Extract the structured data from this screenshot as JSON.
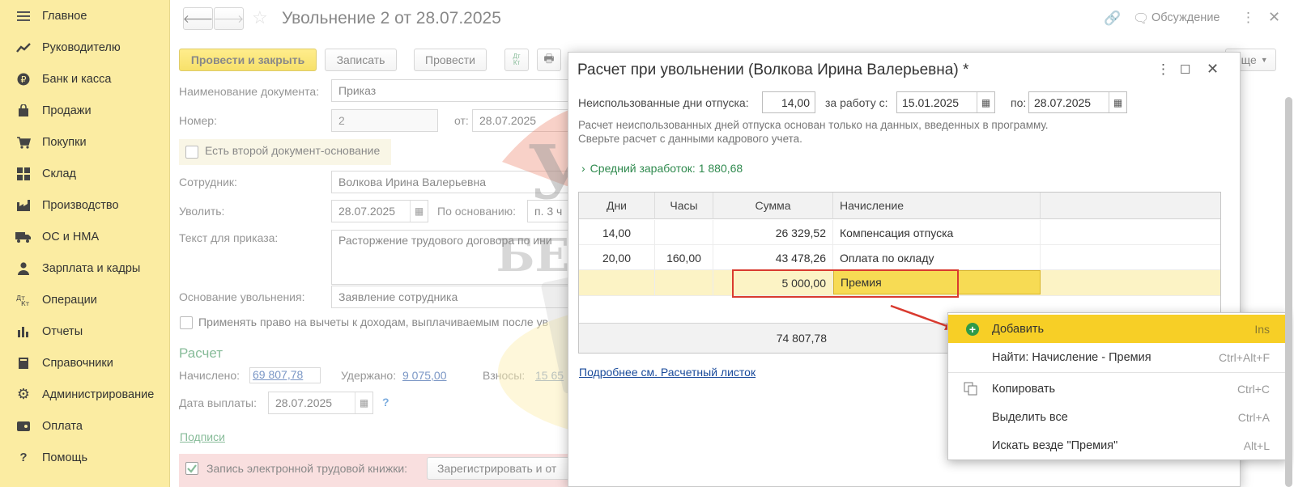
{
  "sidebar": {
    "items": [
      {
        "label": "Главное",
        "icon": "menu-icon"
      },
      {
        "label": "Руководителю",
        "icon": "trend-icon"
      },
      {
        "label": "Банк и касса",
        "icon": "ruble-icon"
      },
      {
        "label": "Продажи",
        "icon": "bag-icon"
      },
      {
        "label": "Покупки",
        "icon": "cart-icon"
      },
      {
        "label": "Склад",
        "icon": "grid-icon"
      },
      {
        "label": "Производство",
        "icon": "factory-icon"
      },
      {
        "label": "ОС и НМА",
        "icon": "truck-icon"
      },
      {
        "label": "Зарплата и кадры",
        "icon": "person-icon"
      },
      {
        "label": "Операции",
        "icon": "dtkt-icon"
      },
      {
        "label": "Отчеты",
        "icon": "barchart-icon"
      },
      {
        "label": "Справочники",
        "icon": "book-icon"
      },
      {
        "label": "Администрирование",
        "icon": "gear-icon"
      },
      {
        "label": "Оплата",
        "icon": "wallet-icon"
      },
      {
        "label": "Помощь",
        "icon": "question-icon"
      }
    ]
  },
  "header": {
    "title": "Увольнение 2 от 28.07.2025",
    "discussion": "Обсуждение"
  },
  "toolbar": {
    "post_close": "Провести и закрыть",
    "save": "Записать",
    "post": "Провести",
    "dtkt": "Дт Кт",
    "more": "Еще"
  },
  "form": {
    "doc_name_label": "Наименование документа:",
    "doc_name": "Приказ",
    "number_label": "Номер:",
    "number": "2",
    "from_label": "от:",
    "from_date": "28.07.2025",
    "second_doc": "Есть второй документ-основание",
    "employee_label": "Сотрудник:",
    "employee": "Волкова Ирина Валерьевна",
    "dismiss_label": "Уволить:",
    "dismiss_date": "28.07.2025",
    "basis_label": "По основанию:",
    "basis": "п. 3 ч",
    "order_text_label": "Текст для приказа:",
    "order_text": "Расторжение трудового договора по ини",
    "reason_label": "Основание увольнения:",
    "reason": "Заявление сотрудника",
    "deductions": "Применять право на вычеты к доходам, выплачиваемым после ув",
    "calc_title": "Расчет",
    "accrued_label": "Начислено:",
    "accrued": "69 807,78",
    "withheld_label": "Удержано:",
    "withheld": "9 075,00",
    "contrib_label": "Взносы:",
    "contrib": "15 65",
    "pay_date_label": "Дата выплаты:",
    "pay_date": "28.07.2025",
    "help": "?",
    "signatures": "Подписи",
    "etk_label": "Запись электронной трудовой книжки:",
    "register_btn": "Зарегистрировать и от"
  },
  "dialog": {
    "title": "Расчет при увольнении (Волкова Ирина Валерьевна) *",
    "unused_label": "Неиспользованные дни отпуска:",
    "unused_days": "14,00",
    "work_from_label": "за работу с:",
    "work_from": "15.01.2025",
    "to_label": "по:",
    "work_to": "28.07.2025",
    "note1": "Расчет неиспользованных дней отпуска основан только на данных, введенных в программу.",
    "note2": "Сверьте расчет с данными кадрового учета.",
    "avg_earnings": "Средний заработок: 1 880,68",
    "columns": [
      "Дни",
      "Часы",
      "Сумма",
      "Начисление"
    ],
    "rows": [
      {
        "days": "14,00",
        "hours": "",
        "sum": "26 329,52",
        "accrual": "Компенсация отпуска"
      },
      {
        "days": "20,00",
        "hours": "160,00",
        "sum": "43 478,26",
        "accrual": "Оплата по окладу"
      },
      {
        "days": "",
        "hours": "",
        "sum": "5 000,00",
        "accrual": "Премия"
      }
    ],
    "total": "74 807,78",
    "payslip_link": "Подробнее см. Расчетный листок"
  },
  "context_menu": {
    "items": [
      {
        "label": "Добавить",
        "key": "Ins"
      },
      {
        "label": "Найти: Начисление - Премия",
        "key": "Ctrl+Alt+F"
      },
      {
        "label": "Копировать",
        "key": "Ctrl+C"
      },
      {
        "label": "Выделить все",
        "key": "Ctrl+A"
      },
      {
        "label": "Искать везде \"Премия\"",
        "key": "Alt+L"
      }
    ]
  },
  "watermark": {
    "line1": "УЧЕТ",
    "line2": "БЕЗ ЗАБОТ"
  },
  "colors": {
    "sidebar_bg": "#fbeca2",
    "primary_button": "#f5d009",
    "accent_green": "#2f8a4e",
    "highlight_row": "#fcf3c5",
    "menu_highlight": "#f7cf26",
    "annotation_red": "#d93a2f"
  }
}
